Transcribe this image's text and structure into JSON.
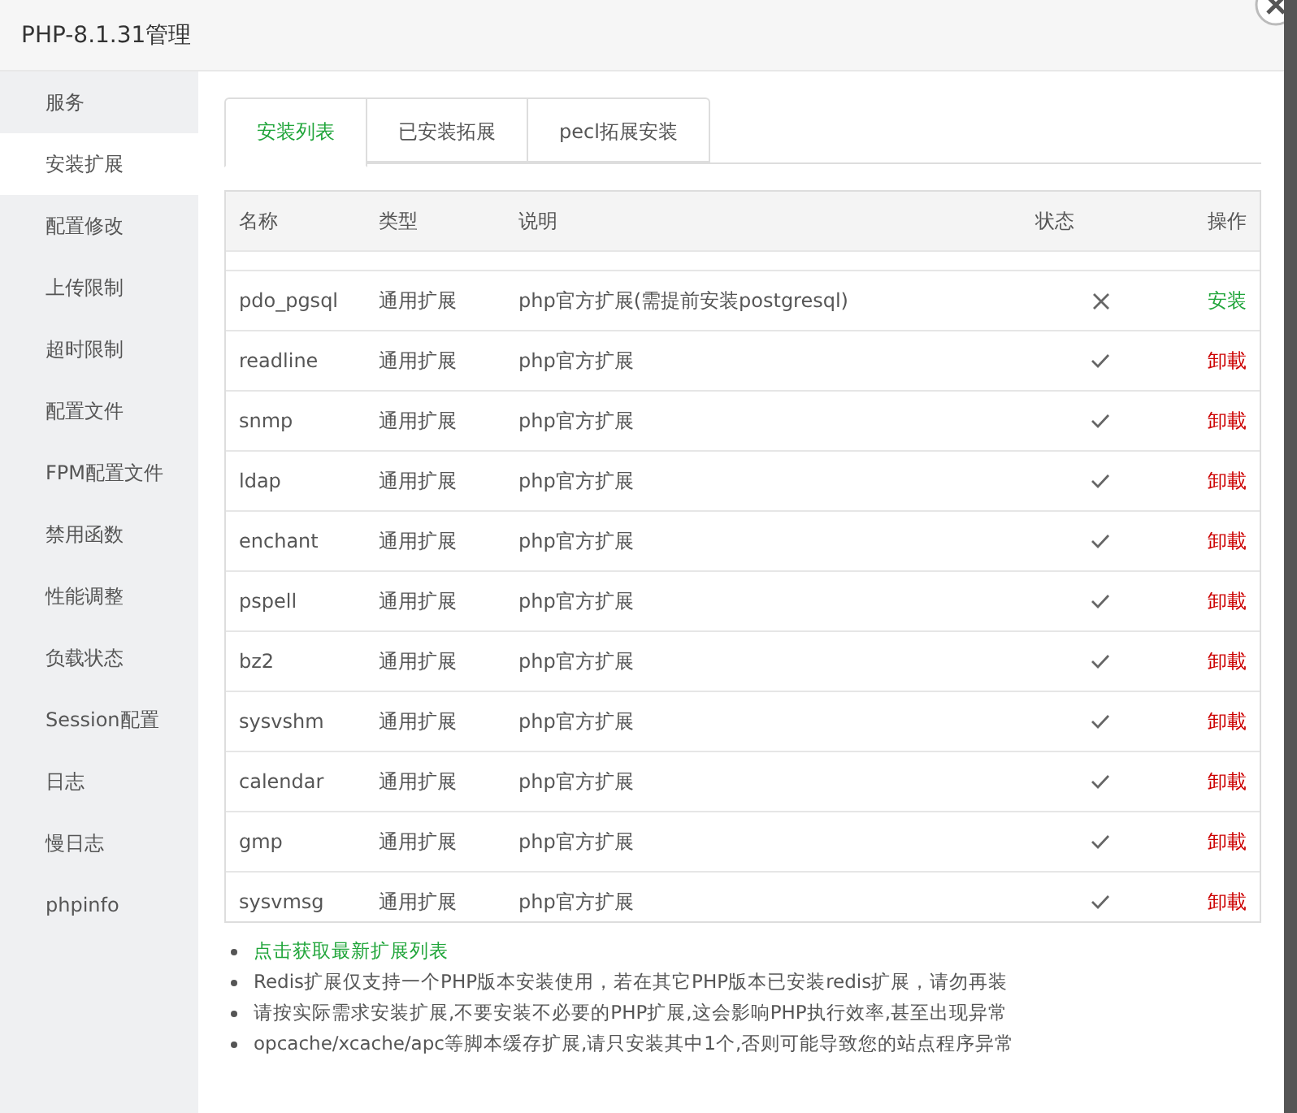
{
  "window": {
    "title": "PHP-8.1.31管理"
  },
  "sidebar": {
    "items": [
      {
        "label": "服务",
        "selected": false
      },
      {
        "label": "安装扩展",
        "selected": true
      },
      {
        "label": "配置修改",
        "selected": false
      },
      {
        "label": "上传限制",
        "selected": false
      },
      {
        "label": "超时限制",
        "selected": false
      },
      {
        "label": "配置文件",
        "selected": false
      },
      {
        "label": "FPM配置文件",
        "selected": false
      },
      {
        "label": "禁用函数",
        "selected": false
      },
      {
        "label": "性能调整",
        "selected": false
      },
      {
        "label": "负载状态",
        "selected": false
      },
      {
        "label": "Session配置",
        "selected": false
      },
      {
        "label": "日志",
        "selected": false
      },
      {
        "label": "慢日志",
        "selected": false
      },
      {
        "label": "phpinfo",
        "selected": false
      }
    ]
  },
  "tabs": [
    {
      "label": "安装列表",
      "selected": true
    },
    {
      "label": "已安装拓展",
      "selected": false
    },
    {
      "label": "pecl拓展安装",
      "selected": false
    }
  ],
  "table": {
    "columns": [
      "名称",
      "类型",
      "说明",
      "状态",
      "操作"
    ],
    "rows": [
      {
        "name": "pdo_pgsql",
        "type": "通用扩展",
        "description": "php官方扩展(需提前安装postgresql)",
        "installed": false,
        "action": "安装"
      },
      {
        "name": "readline",
        "type": "通用扩展",
        "description": "php官方扩展",
        "installed": true,
        "action": "卸載"
      },
      {
        "name": "snmp",
        "type": "通用扩展",
        "description": "php官方扩展",
        "installed": true,
        "action": "卸載"
      },
      {
        "name": "ldap",
        "type": "通用扩展",
        "description": "php官方扩展",
        "installed": true,
        "action": "卸載"
      },
      {
        "name": "enchant",
        "type": "通用扩展",
        "description": "php官方扩展",
        "installed": true,
        "action": "卸載"
      },
      {
        "name": "pspell",
        "type": "通用扩展",
        "description": "php官方扩展",
        "installed": true,
        "action": "卸載"
      },
      {
        "name": "bz2",
        "type": "通用扩展",
        "description": "php官方扩展",
        "installed": true,
        "action": "卸載"
      },
      {
        "name": "sysvshm",
        "type": "通用扩展",
        "description": "php官方扩展",
        "installed": true,
        "action": "卸載"
      },
      {
        "name": "calendar",
        "type": "通用扩展",
        "description": "php官方扩展",
        "installed": true,
        "action": "卸載"
      },
      {
        "name": "gmp",
        "type": "通用扩展",
        "description": "php官方扩展",
        "installed": true,
        "action": "卸載"
      },
      {
        "name": "sysvmsg",
        "type": "通用扩展",
        "description": "php官方扩展",
        "installed": true,
        "action": "卸載"
      }
    ]
  },
  "notes": [
    {
      "text": "点击获取最新扩展列表",
      "kind": "link"
    },
    {
      "text": "Redis扩展仅支持一个PHP版本安装使用，若在其它PHP版本已安装redis扩展，请勿再装",
      "kind": "text"
    },
    {
      "text": "请按实际需求安装扩展,不要安装不必要的PHP扩展,这会影响PHP执行效率,甚至出现异常",
      "kind": "text"
    },
    {
      "text": "opcache/xcache/apc等脚本缓存扩展,请只安装其中1个,否则可能导致您的站点程序异常",
      "kind": "text"
    }
  ]
}
